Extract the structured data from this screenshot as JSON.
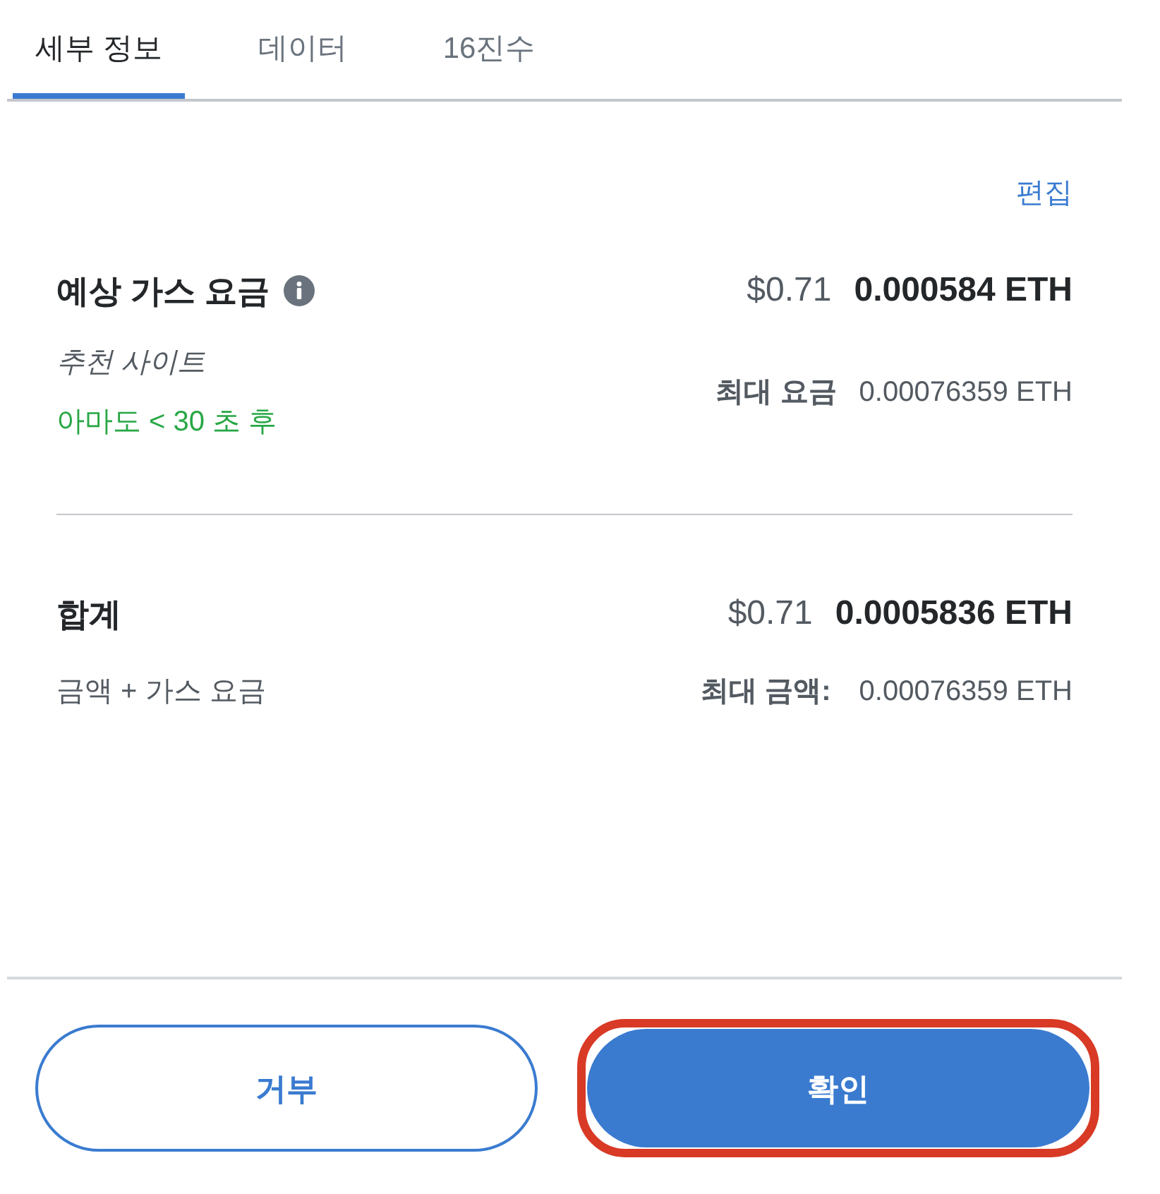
{
  "tabs": [
    {
      "label": "세부 정보",
      "selected": true
    },
    {
      "label": "데이터",
      "selected": false
    },
    {
      "label": "16진수",
      "selected": false
    }
  ],
  "edit_link": "편집",
  "gas_fee": {
    "label": "예상 가스 요금",
    "fiat": "$0.71",
    "amount": "0.000584 ETH",
    "site_suggestion": "추천 사이트",
    "timing": "아마도 < 30 초 후",
    "max_label": "최대 요금",
    "max_amount": "0.00076359 ETH"
  },
  "total": {
    "label": "합계",
    "fiat": "$0.71",
    "amount": "0.0005836 ETH",
    "sublabel": "금액 + 가스 요금",
    "max_label": "최대 금액:",
    "max_amount": "0.00076359 ETH"
  },
  "buttons": [
    {
      "label": "거부",
      "kind": "secondary",
      "highlighted": false
    },
    {
      "label": "확인",
      "kind": "primary",
      "highlighted": true
    }
  ]
}
